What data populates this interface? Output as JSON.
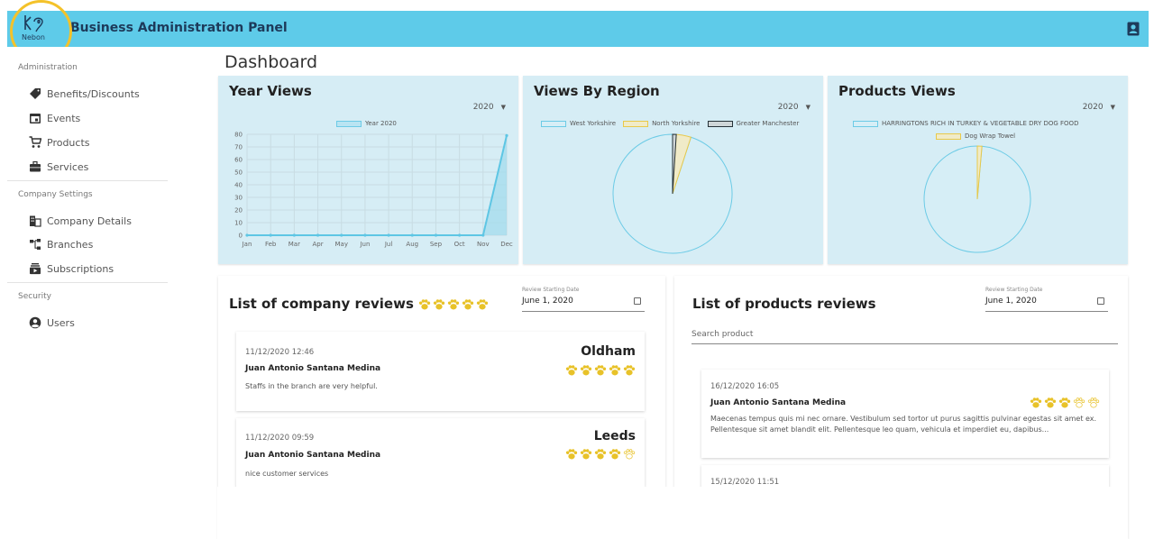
{
  "app": {
    "title": "Business Administration Panel",
    "logo_text": "Nebon"
  },
  "sidebar": {
    "sections": [
      {
        "label": "Administration"
      },
      {
        "label": "Company Settings"
      },
      {
        "label": "Security"
      }
    ],
    "items": [
      {
        "label": "Benefits/Discounts",
        "icon": "tag-icon"
      },
      {
        "label": "Events",
        "icon": "calendar-icon"
      },
      {
        "label": "Products",
        "icon": "cart-icon"
      },
      {
        "label": "Services",
        "icon": "briefcase-icon"
      },
      {
        "label": "Company Details",
        "icon": "domain-icon"
      },
      {
        "label": "Branches",
        "icon": "branches-icon"
      },
      {
        "label": "Subscriptions",
        "icon": "subscriptions-icon"
      },
      {
        "label": "Users",
        "icon": "account-circle-icon"
      }
    ]
  },
  "page": {
    "title": "Dashboard"
  },
  "cards": {
    "year_views": {
      "title": "Year Views",
      "year": "2020"
    },
    "views_by_region": {
      "title": "Views By Region",
      "year": "2020"
    },
    "products_views": {
      "title": "Products Views",
      "year": "2020"
    }
  },
  "chart_data": [
    {
      "type": "area",
      "title": "Year Views",
      "categories": [
        "Jan",
        "Feb",
        "Mar",
        "Apr",
        "May",
        "Jun",
        "Jul",
        "Aug",
        "Sep",
        "Oct",
        "Nov",
        "Dec"
      ],
      "series": [
        {
          "name": "Year 2020",
          "values": [
            0,
            0,
            0,
            0,
            0,
            0,
            0,
            0,
            0,
            0,
            0,
            79
          ]
        }
      ],
      "yticks": [
        0,
        10,
        20,
        30,
        40,
        50,
        60,
        70,
        80
      ],
      "ylim": [
        0,
        80
      ],
      "grid": true,
      "legend": "top"
    },
    {
      "type": "pie",
      "title": "Views By Region",
      "labels": [
        "West Yorkshire",
        "North Yorkshire",
        "Greater Manchester"
      ],
      "values": [
        95,
        4,
        1
      ],
      "colors": [
        "#d6eef6",
        "#f0ebc8",
        "#cfd6d8"
      ],
      "border_colors": [
        "#6ccbe6",
        "#e8c94a",
        "#263238"
      ],
      "legend": "top"
    },
    {
      "type": "pie",
      "title": "Products Views",
      "labels": [
        "HARRINGTONS RICH IN TURKEY & VEGETABLE DRY DOG FOOD",
        "Dog Wrap Towel"
      ],
      "values": [
        98.6,
        1.4
      ],
      "colors": [
        "#d6eef6",
        "#f0ebc8"
      ],
      "border_colors": [
        "#6ccbe6",
        "#e8c94a"
      ],
      "legend": "top"
    }
  ],
  "company_reviews": {
    "title": "List of company reviews",
    "rating": 4.5,
    "date_label": "Review Starting Date",
    "date_value": "June 1, 2020",
    "items": [
      {
        "date": "11/12/2020 12:46",
        "name": "Juan Antonio Santana Medina",
        "text": "Staffs in the branch are very helpful.",
        "branch": "Oldham",
        "rating": 5
      },
      {
        "date": "11/12/2020 09:59",
        "name": "Juan Antonio Santana Medina",
        "text": "nice customer services",
        "branch": "Leeds",
        "rating": 4
      }
    ]
  },
  "product_reviews": {
    "title": "List of products reviews",
    "date_label": "Review Starting Date",
    "date_value": "June 1, 2020",
    "search_placeholder": "Search product",
    "items": [
      {
        "date": "16/12/2020 16:05",
        "name": "Juan Antonio Santana Medina",
        "text": "Maecenas tempus quis mi nec ornare. Vestibulum sed tortor ut purus sagittis pulvinar egestas sit amet ex. Pellentesque sit amet blandit elit. Pellentesque leo quam, vehicula et imperdiet eu, dapibus...",
        "rating": 3
      },
      {
        "date": "15/12/2020 11:51"
      }
    ]
  },
  "colors": {
    "topbar": "#5ecbe9",
    "accent_gold": "#e8c229",
    "chart_line": "#6ccbe6",
    "card_bg": "#d6edf5"
  }
}
